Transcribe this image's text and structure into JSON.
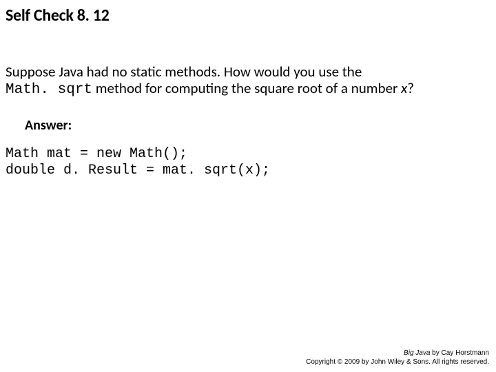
{
  "title": "Self Check 8. 12",
  "question": {
    "part1": "Suppose Java had no static methods. How would you use the",
    "code": "Math. sqrt",
    "part2": " method for computing the square root of a number ",
    "var": "x",
    "part3": "?"
  },
  "answer_label": "Answer:",
  "code_lines": [
    "Math mat = new Math();",
    "double d. Result = mat. sqrt(x);"
  ],
  "footer": {
    "book": "Big Java",
    "byline": " by Cay Horstmann",
    "copyright": "Copyright © 2009 by John Wiley & Sons. All rights reserved."
  }
}
